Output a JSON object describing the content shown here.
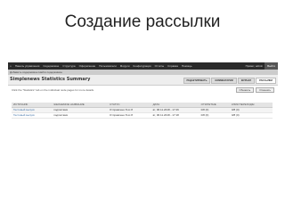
{
  "slide": {
    "title": "Создание рассылки"
  },
  "admin_bar": {
    "menu": [
      "Панель управления",
      "Содержимое",
      "Структура",
      "Оформление",
      "Пользователи",
      "Модули",
      "Конфигурация",
      "Отчёты",
      "Справка",
      "Помощь"
    ],
    "account": "Привет, admin",
    "logout": "Выйти"
  },
  "shortcuts": {
    "label": "Добавить содержимое   Найти содержимое"
  },
  "page": {
    "title": "Simplenews Statistics Summary",
    "tabs": [
      "РЕДАКТИРОВАТЬ",
      "КОММЕНТАРИИ",
      "ЖУРНАЛ",
      "РАССЫЛКИ"
    ],
    "active_tab": 3
  },
  "content": {
    "help": "Click the \"Statistics\" tab on the individual node pages for more details.",
    "actions": [
      "Обновить",
      "Отменить"
    ],
    "table": {
      "headers": [
        "ИСТОЧНИК",
        "ЖЕЛАЕМОЕ НАЗВАНИЕ",
        "СТАТУС",
        "ДАТА",
        "ОТКРЫТЫЕ",
        "КЛИК ПЕРЕХОДЫ"
      ],
      "rows": [
        [
          "Тестовый выпуск",
          "подписчики",
          "Отправлено 8 из 8",
          "вт, 06.11.2018 - 17:26",
          "0/8 (0)",
          "0/8 (0)"
        ],
        [
          "Тестовый выпуск",
          "подписчики",
          "Отправлено 8 из 8",
          "вт, 06.11.2018 - 17:18",
          "0/8 (0)",
          "0/8 (0)"
        ]
      ]
    }
  }
}
